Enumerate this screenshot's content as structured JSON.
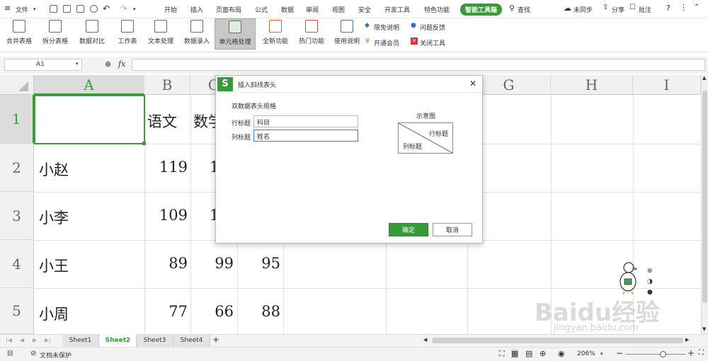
{
  "menubar": {
    "file": "文件",
    "tabs": [
      "开始",
      "插入",
      "页面布局",
      "公式",
      "数据",
      "审阅",
      "视图",
      "安全",
      "开发工具",
      "特色功能"
    ],
    "active_tab": "智能工具箱",
    "search": "查找",
    "sync": "未同步",
    "share": "分享",
    "comment": "批注"
  },
  "ribbon": {
    "buttons": [
      "合并表格",
      "拆分表格",
      "数据对比",
      "工作表",
      "文本处理",
      "数据录入",
      "单元格处理",
      "全新功能",
      "热门功能",
      "使用说明"
    ],
    "small": {
      "free": "限免说明",
      "member": "开通会员",
      "feedback": "问题反馈",
      "close": "关闭工具"
    }
  },
  "formula_bar": {
    "name_box": "A1",
    "fx": "fx"
  },
  "sheet": {
    "columns": [
      "A",
      "B",
      "C",
      "D",
      "E",
      "F",
      "G",
      "H",
      "I"
    ],
    "rows": [
      "1",
      "2",
      "3",
      "4",
      "5"
    ],
    "header_row": [
      "语文",
      "数学"
    ],
    "data": [
      {
        "name": "小赵",
        "b": "119",
        "c": "1",
        "d": ""
      },
      {
        "name": "小李",
        "b": "109",
        "c": "1",
        "d": ""
      },
      {
        "name": "小王",
        "b": "89",
        "c": "99",
        "d": "95"
      },
      {
        "name": "小周",
        "b": "77",
        "c": "66",
        "d": "88"
      }
    ]
  },
  "dialog": {
    "title": "插入斜线表头",
    "section": "双数据表头规格",
    "row_label": "行标题",
    "row_value": "科目",
    "col_label": "列标题",
    "col_value": "姓名",
    "preview_title": "示意图",
    "preview_row": "行标题",
    "preview_col": "列标题",
    "ok": "确定",
    "cancel": "取消"
  },
  "sheet_tabs": [
    "Sheet1",
    "Sheet2",
    "Sheet3",
    "Sheet4"
  ],
  "active_sheet": "Sheet2",
  "status": {
    "protect": "文档未保护",
    "zoom": "206%"
  },
  "watermark": {
    "text": "Baidu经验",
    "url": "jingyan.baidu.com"
  },
  "colors": {
    "accent": "#3a9a3a",
    "selection": "#3d9a3d"
  }
}
